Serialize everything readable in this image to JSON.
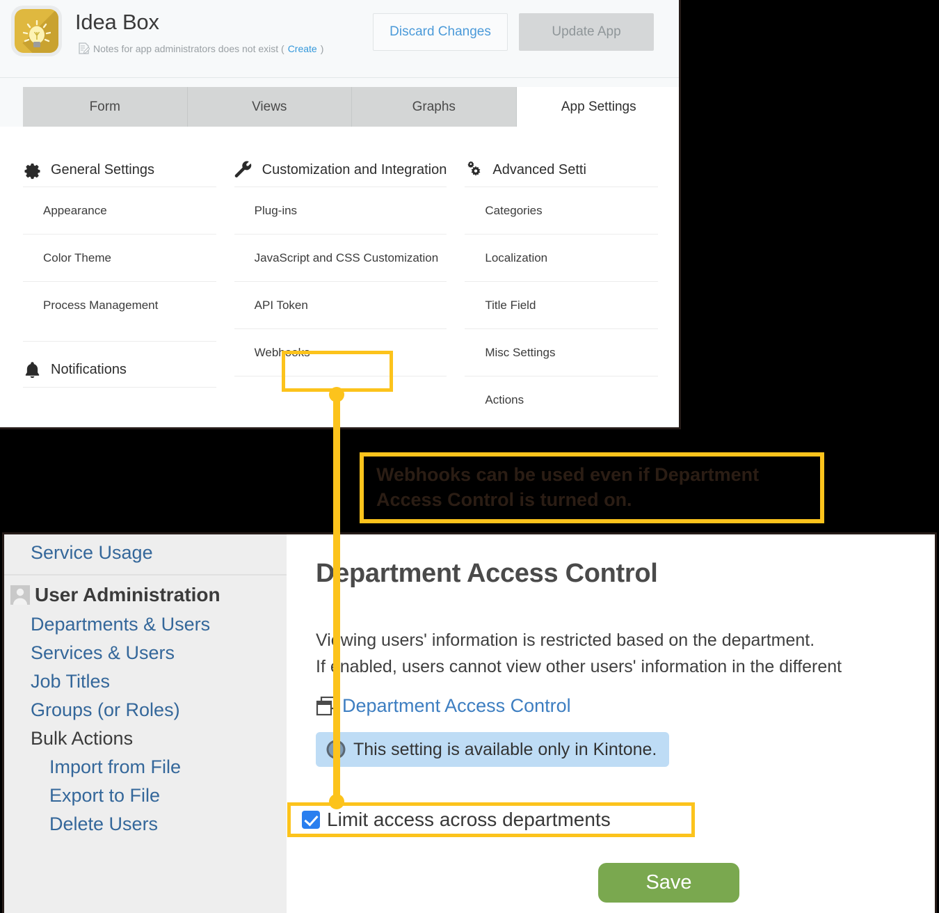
{
  "top_panel": {
    "app": {
      "icon_name": "lightbulb-app-icon",
      "title": "Idea Box",
      "notes_text": "Notes for app administrators does not exist (",
      "notes_link": "Create",
      "notes_suffix": ")"
    },
    "buttons": {
      "discard": "Discard Changes",
      "update": "Update App"
    },
    "tabs": [
      {
        "label": "Form",
        "active": false
      },
      {
        "label": "Views",
        "active": false
      },
      {
        "label": "Graphs",
        "active": false
      },
      {
        "label": "App Settings",
        "active": true
      }
    ],
    "columns": [
      {
        "heading": "General Settings",
        "icon": "gear-icon",
        "items": [
          "Appearance",
          "Color Theme",
          "Process Management"
        ],
        "heading2": "Notifications",
        "icon2": "bell-icon"
      },
      {
        "heading": "Customization and Integration",
        "icon": "wrench-icon",
        "items": [
          "Plug-ins",
          "JavaScript and CSS Customization",
          "API Token",
          "Webhooks"
        ]
      },
      {
        "heading": "Advanced Setti",
        "icon": "gears-icon",
        "items": [
          "Categories",
          "Localization",
          "Title Field",
          "Misc Settings",
          "Actions"
        ]
      }
    ]
  },
  "callout": {
    "text": "Webhooks can be used even if Department\nAccess Control is turned on.",
    "border_color": "#fcc31c"
  },
  "bottom_panel": {
    "side_nav": {
      "top_link": "Service Usage",
      "section": "User Administration",
      "section_icon": "person-icon",
      "links": [
        "Departments & Users",
        "Services & Users",
        "Job Titles",
        "Groups (or Roles)"
      ],
      "group_label": "Bulk Actions",
      "sub_links": [
        "Import from File",
        "Export to File",
        "Delete Users"
      ]
    },
    "content": {
      "title": "Department Access Control",
      "desc_line1": "Viewing users' information is restricted based on the department.",
      "desc_line2": "If enabled, users cannot view other users' information in the different",
      "link": "Department Access Control",
      "link_icon": "window-icon",
      "info_text": "This setting is available only in Kintone.",
      "info_icon": "info-icon",
      "checkbox_label": "Limit access across departments",
      "checkbox_checked": true,
      "save_label": "Save",
      "save_color": "#7aa84f"
    }
  }
}
